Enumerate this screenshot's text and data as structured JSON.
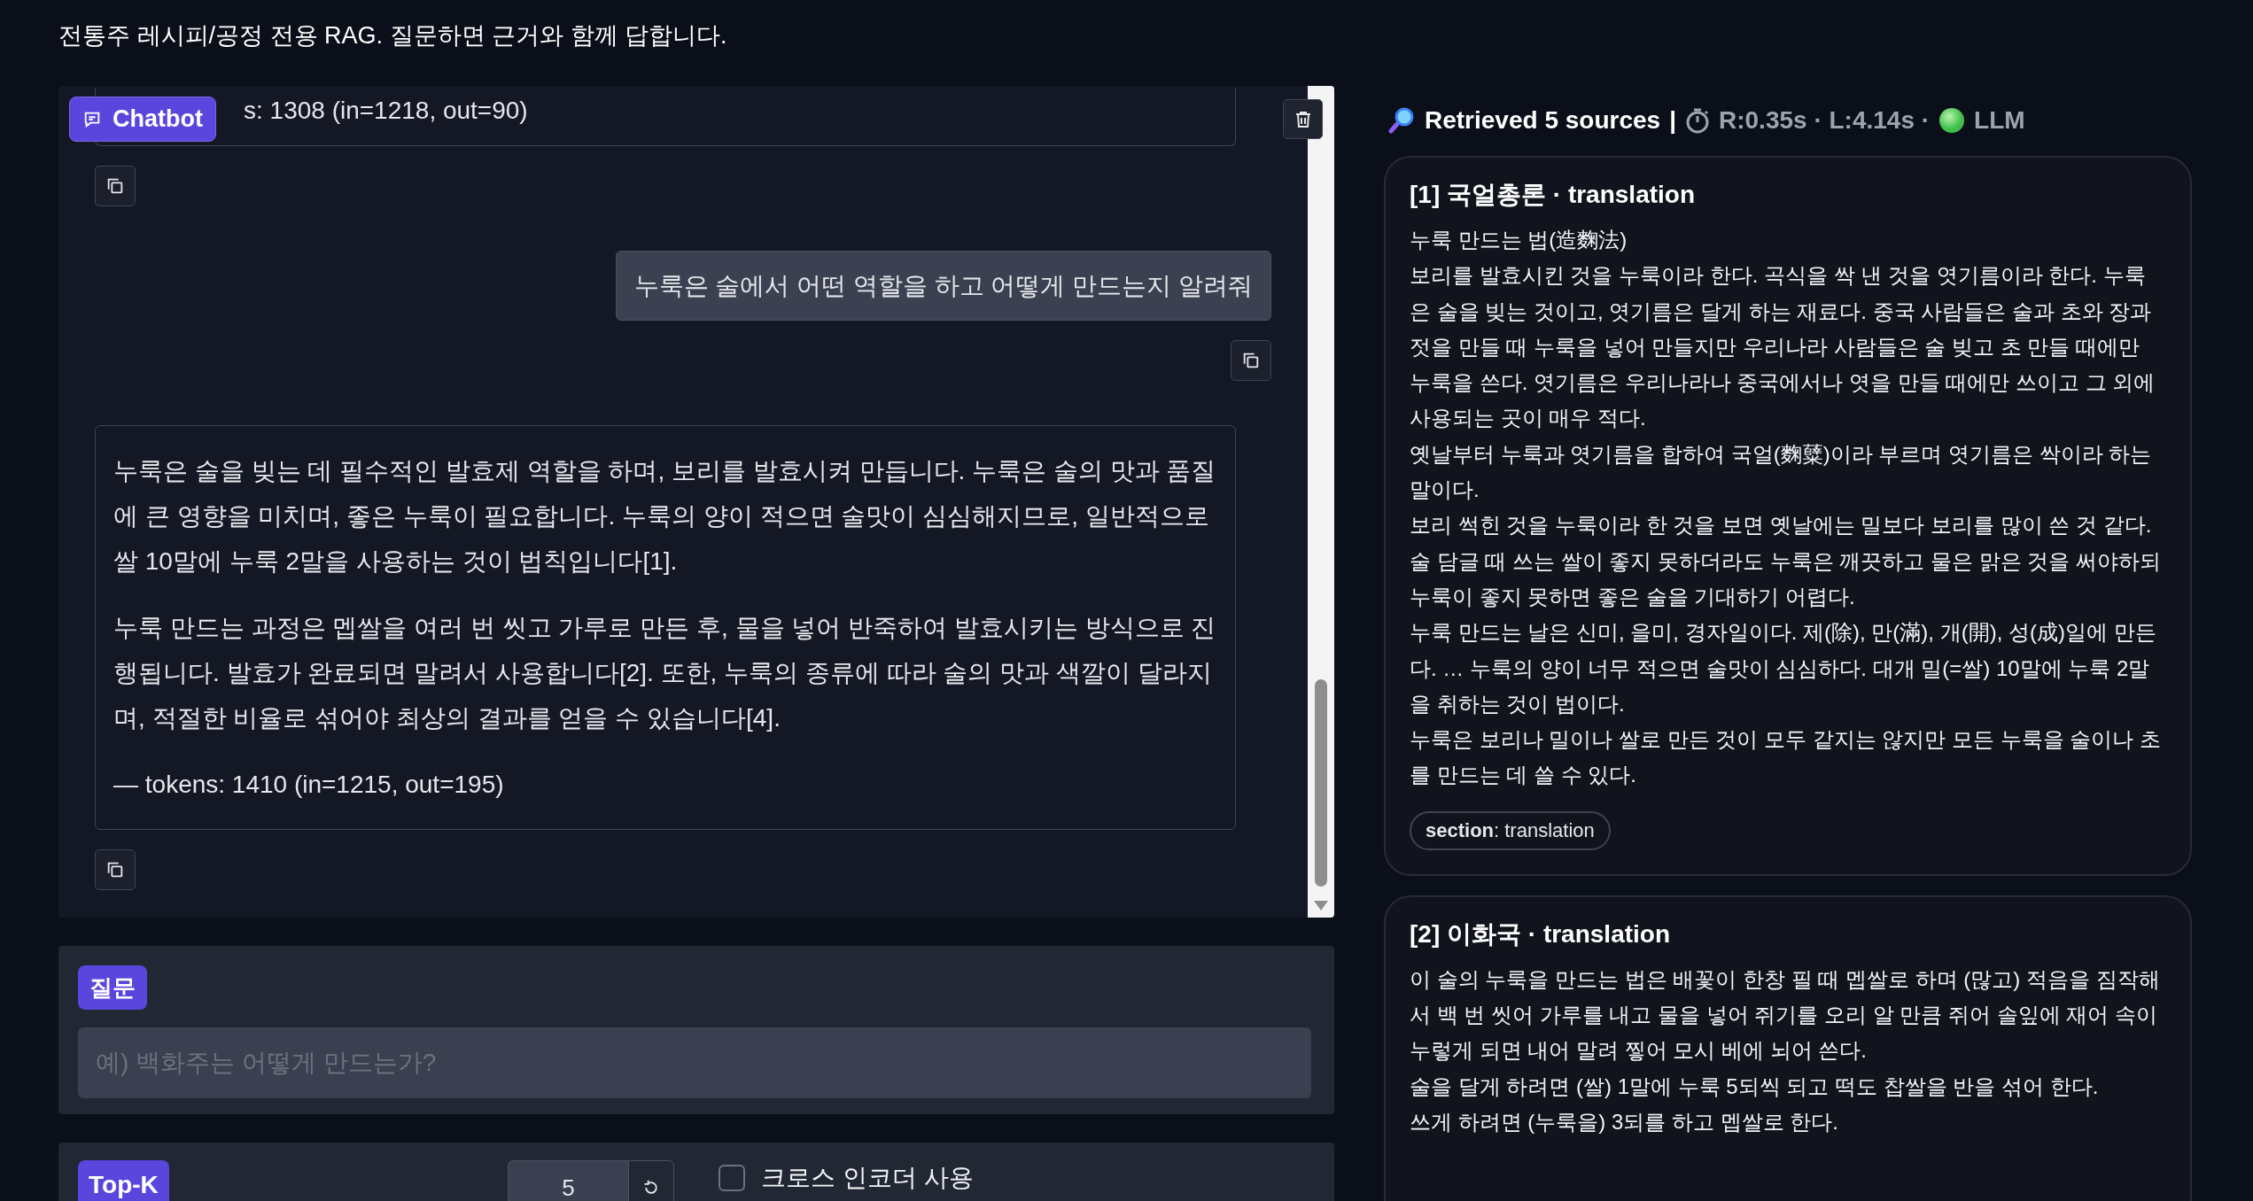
{
  "intro": "전통주 레시피/공정 전용 RAG. 질문하면 근거와 함께 답합니다.",
  "chatbot": {
    "label": "Chatbot",
    "messages": [
      {
        "kind": "bot",
        "footer": "s: 1308 (in=1218, out=90)"
      },
      {
        "kind": "user",
        "text": "누룩은 술에서 어떤 역할을 하고 어떻게 만드는지 알려줘"
      },
      {
        "kind": "bot",
        "paragraphs": [
          "누룩은 술을 빚는 데 필수적인 발효제 역할을 하며, 보리를 발효시켜 만듭니다. 누룩은 술의 맛과 품질에 큰 영향을 미치며, 좋은 누룩이 필요합니다. 누룩의 양이 적으면 술맛이 심심해지므로, 일반적으로 쌀 10말에 누룩 2말을 사용하는 것이 법칙입니다[1].",
          "누룩 만드는 과정은 멥쌀을 여러 번 씻고 가루로 만든 후, 물을 넣어 반죽하여 발효시키는 방식으로 진행됩니다. 발효가 완료되면 말려서 사용합니다[2]. 또한, 누룩의 종류에 따라 술의 맛과 색깔이 달라지며, 적절한 비율로 섞어야 최상의 결과를 얻을 수 있습니다[4]."
        ],
        "footer": "— tokens: 1410 (in=1215, out=195)"
      }
    ]
  },
  "question": {
    "label": "질문",
    "placeholder": "예) 백화주는 어떻게 만드는가?"
  },
  "top_k": {
    "label": "Top-K",
    "value": "5"
  },
  "cross_encoder": {
    "label": "크로스 인코더 사용",
    "checked": false
  },
  "retrieval": {
    "summary": "Retrieved 5 sources",
    "separator": "|",
    "timing": "R:0.35s · L:4.14s ·",
    "mode": "LLM",
    "sources": [
      {
        "title": "[1] 국얼총론 · translation",
        "lines": [
          "누룩 만드는 법(造麴法)",
          "보리를 발효시킨 것을 누룩이라 한다. 곡식을 싹 낸 것을 엿기름이라 한다. 누룩은 술을 빚는 것이고, 엿기름은 달게 하는 재료다. 중국 사람들은 술과 초와 장과 젓을 만들 때 누룩을 넣어 만들지만 우리나라 사람들은 술 빚고 초 만들 때에만 누룩을 쓴다. 엿기름은 우리나라나 중국에서나 엿을 만들 때에만 쓰이고 그 외에 사용되는 곳이 매우 적다.",
          "옛날부터 누룩과 엿기름을 합하여 국얼(麴糵)이라 부르며 엿기름은 싹이라 하는 말이다.",
          "보리 썩힌 것을 누룩이라 한 것을 보면 옛날에는 밀보다 보리를 많이 쓴 것 같다.",
          "술 담글 때 쓰는 쌀이 좋지 못하더라도 누룩은 깨끗하고 물은 맑은 것을 써야하되 누룩이 좋지 못하면 좋은 술을 기대하기 어렵다.",
          "누룩 만드는 날은 신미, 을미, 경자일이다. 제(除), 만(滿), 개(開), 성(成)일에 만든다. … 누룩의 양이 너무 적으면 술맛이 심심하다. 대개 밀(=쌀) 10말에 누룩 2말을 취하는 것이 법이다.",
          "누룩은 보리나 밀이나 쌀로 만든 것이 모두 같지는 않지만 모든 누룩을 술이나 초를 만드는 데 쓸 수 있다."
        ],
        "tag": "**section**: translation"
      },
      {
        "title": "[2] 이화국 · translation",
        "lines": [
          "이 술의 누룩을 만드는 법은 배꽃이 한창 필 때 멥쌀로 하며 (많고) 적음을 짐작해서 백 번 씻어 가루를 내고 물을 넣어 쥐기를 오리 알 만큼 쥐어 솔잎에 재어 속이 누렇게 되면 내어 말려 찧어 모시 베에 뇌어 쓴다.",
          "술을 달게 하려면 (쌀) 1말에 누룩 5되씩 되고 떡도 찹쌀을 반을 섞어 한다.",
          "쓰게 하려면 (누룩을) 3되를 하고 멥쌀로 한다."
        ]
      }
    ]
  }
}
